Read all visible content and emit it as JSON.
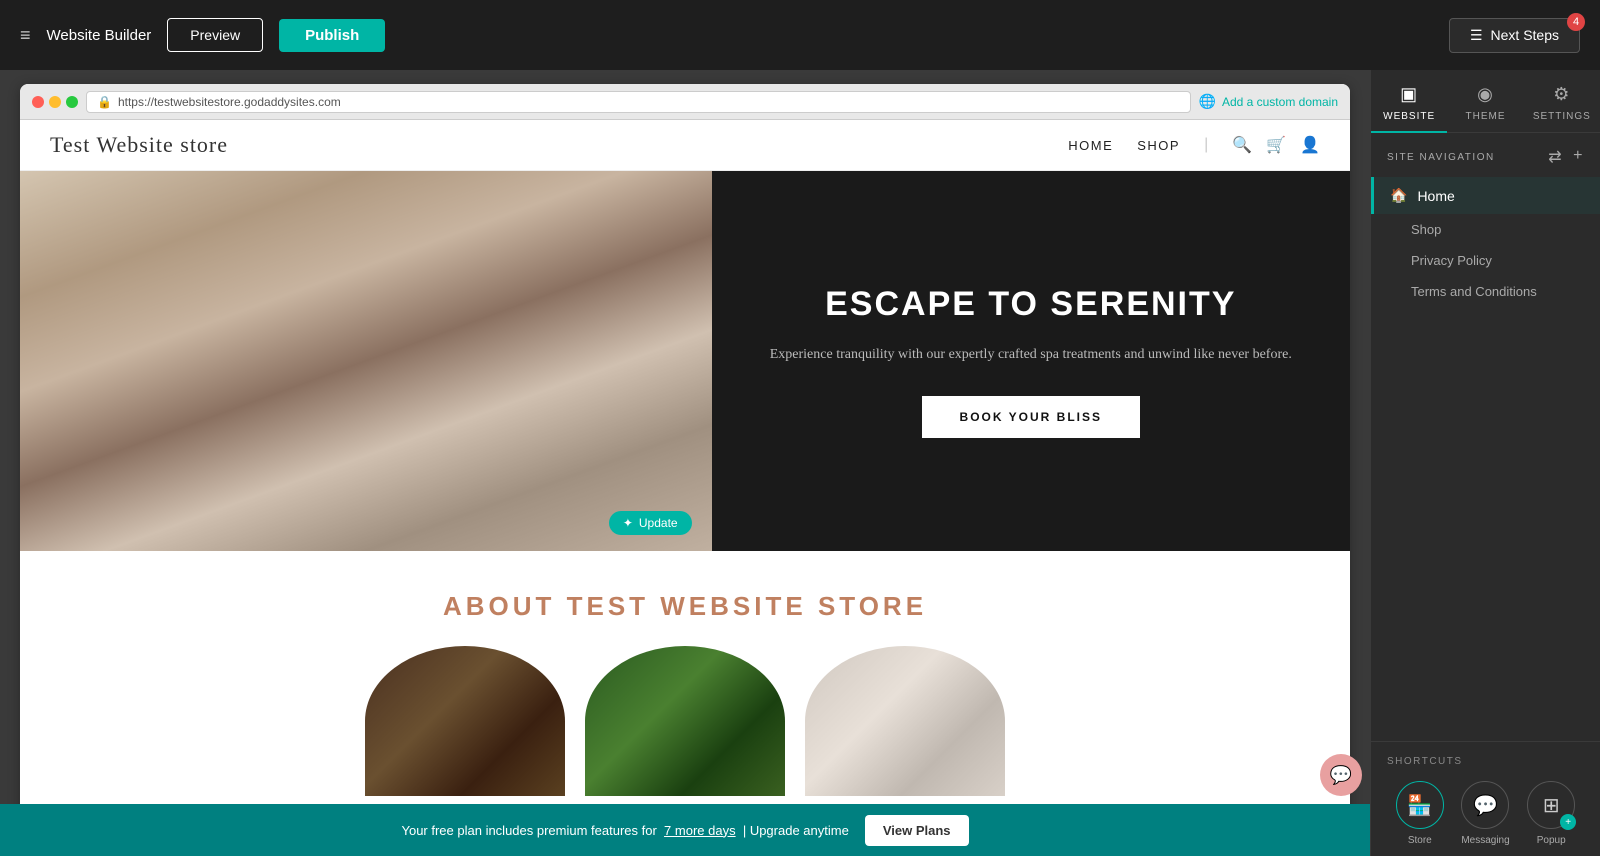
{
  "toolbar": {
    "hamburger": "≡",
    "site_title": "Website Builder",
    "preview_label": "Preview",
    "publish_label": "Publish",
    "next_steps_label": "Next Steps",
    "notification_count": "4"
  },
  "browser": {
    "url": "https://testwebsitestore.godaddysites.com",
    "custom_domain_label": "Add a custom domain"
  },
  "website": {
    "logo": "Test Website store",
    "nav_home": "HOME",
    "nav_shop": "SHOP",
    "hero_title": "ESCAPE TO SERENITY",
    "hero_subtitle": "Experience tranquility with our expertly crafted spa treatments and unwind like never before.",
    "hero_btn": "BOOK YOUR BLISS",
    "update_label": "Update",
    "about_title": "ABOUT TEST WEBSITE STORE"
  },
  "banner": {
    "text_before": "Your free plan includes premium features for",
    "link_text": "7 more days",
    "text_after": "| Upgrade anytime",
    "btn_label": "View Plans"
  },
  "right_panel": {
    "tabs": [
      {
        "id": "website",
        "label": "WEBSITE",
        "icon": "▣"
      },
      {
        "id": "theme",
        "label": "THEME",
        "icon": "◉"
      },
      {
        "id": "settings",
        "label": "SETTINGS",
        "icon": "⚙"
      }
    ],
    "active_tab": "website",
    "site_navigation_label": "SITE NAVIGATION",
    "nav_items": [
      {
        "id": "home",
        "label": "Home",
        "active": true
      },
      {
        "id": "shop",
        "label": "Shop",
        "active": false
      },
      {
        "id": "privacy-policy",
        "label": "Privacy Policy",
        "active": false
      },
      {
        "id": "terms",
        "label": "Terms and Conditions",
        "active": false
      }
    ],
    "shortcuts_label": "SHORTCUTS",
    "shortcuts": [
      {
        "id": "store",
        "label": "Store",
        "icon": "🏪",
        "has_plus": false,
        "teal": true
      },
      {
        "id": "messaging",
        "label": "Messaging",
        "icon": "💬",
        "has_plus": false,
        "teal": false
      },
      {
        "id": "popup",
        "label": "Popup",
        "icon": "⊞",
        "has_plus": true,
        "teal": false
      }
    ]
  }
}
